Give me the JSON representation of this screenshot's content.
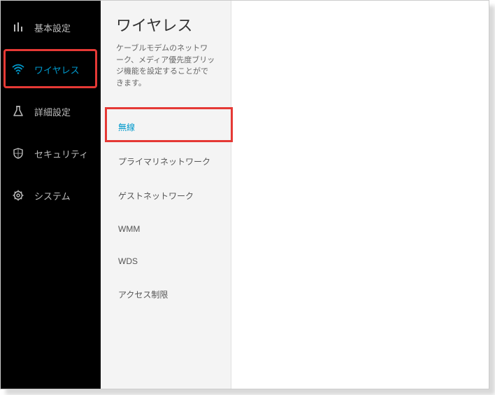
{
  "sidebar": {
    "items": [
      {
        "label": "基本設定"
      },
      {
        "label": "ワイヤレス"
      },
      {
        "label": "詳細設定"
      },
      {
        "label": "セキュリティ"
      },
      {
        "label": "システム"
      }
    ]
  },
  "submenu": {
    "title": "ワイヤレス",
    "description": "ケーブルモデムのネットワーク、メディア優先度ブリッジ機能を設定することができます。",
    "items": [
      {
        "label": "無線"
      },
      {
        "label": "プライマリネットワーク"
      },
      {
        "label": "ゲストネットワーク"
      },
      {
        "label": "WMM"
      },
      {
        "label": "WDS"
      },
      {
        "label": "アクセス制限"
      }
    ]
  }
}
